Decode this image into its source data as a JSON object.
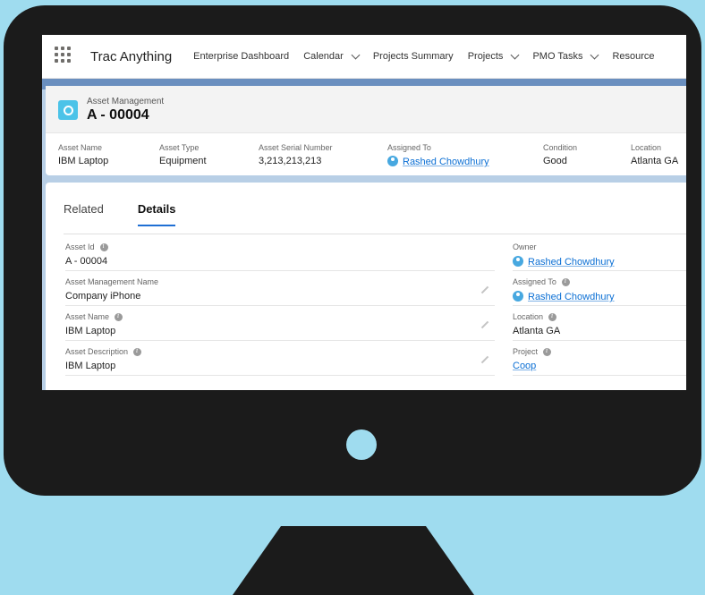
{
  "app": {
    "name": "Trac Anything",
    "nav": [
      {
        "label": "Enterprise Dashboard",
        "dropdown": false
      },
      {
        "label": "Calendar",
        "dropdown": true
      },
      {
        "label": "Projects Summary",
        "dropdown": false
      },
      {
        "label": "Projects",
        "dropdown": true
      },
      {
        "label": "PMO Tasks",
        "dropdown": true
      },
      {
        "label": "Resource",
        "dropdown": false
      }
    ]
  },
  "record": {
    "object_label": "Asset Management",
    "title": "A - 00004",
    "highlights": [
      {
        "label": "Asset Name",
        "value": "IBM Laptop"
      },
      {
        "label": "Asset Type",
        "value": "Equipment"
      },
      {
        "label": "Asset Serial Number",
        "value": "3,213,213,213"
      },
      {
        "label": "Assigned To",
        "value": "Rashed Chowdhury"
      },
      {
        "label": "Condition",
        "value": "Good"
      },
      {
        "label": "Location",
        "value": "Atlanta GA"
      }
    ]
  },
  "tabs": {
    "related": "Related",
    "details": "Details"
  },
  "details": {
    "left": [
      {
        "label": "Asset Id",
        "value": "A - 00004"
      },
      {
        "label": "Asset Management Name",
        "value": "Company iPhone"
      },
      {
        "label": "Asset Name",
        "value": "IBM Laptop"
      },
      {
        "label": "Asset Description",
        "value": "IBM Laptop"
      }
    ],
    "right": [
      {
        "label": "Owner",
        "value": "Rashed Chowdhury"
      },
      {
        "label": "Assigned To",
        "value": "Rashed Chowdhury"
      },
      {
        "label": "Location",
        "value": "Atlanta GA"
      },
      {
        "label": "Project",
        "value": "Coop"
      }
    ]
  },
  "colors": {
    "accent": "#1f6fd4",
    "link": "#0b6fd4",
    "background": "#9fdcef",
    "monitor": "#1b1b1b"
  }
}
